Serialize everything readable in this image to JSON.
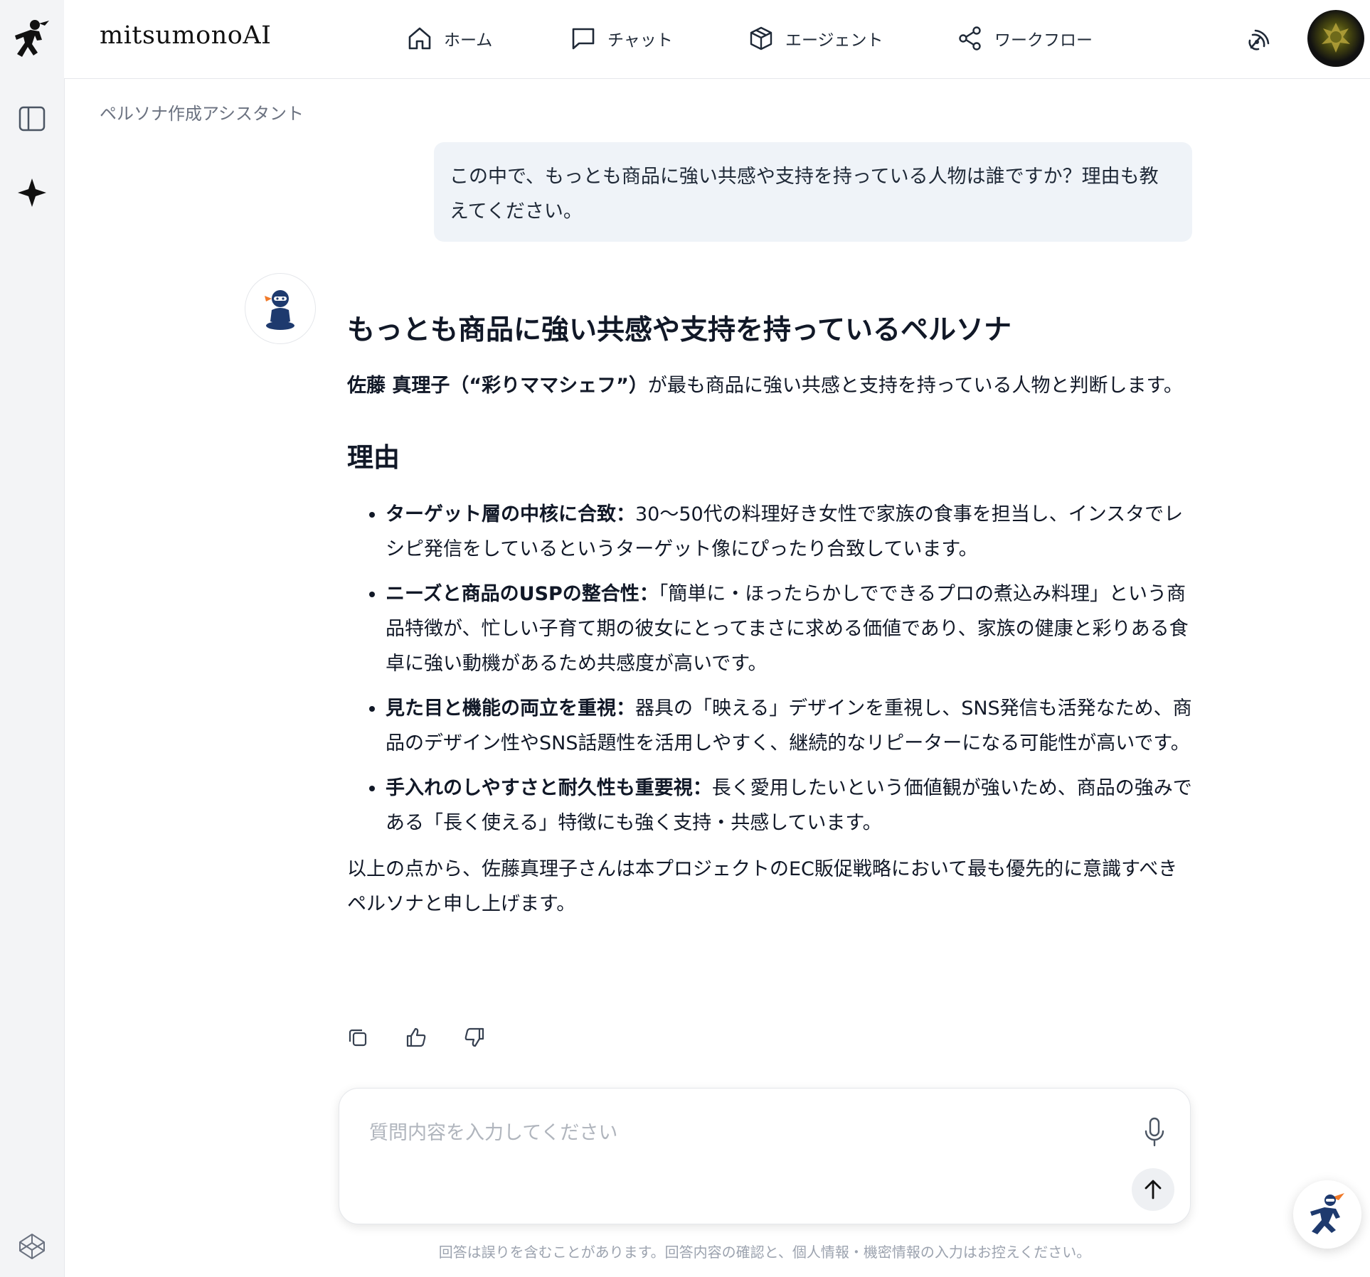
{
  "app": {
    "name": "mitsumonoAI"
  },
  "nav": [
    {
      "label": "ホーム",
      "icon": "home-icon"
    },
    {
      "label": "チャット",
      "icon": "chat-icon"
    },
    {
      "label": "エージェント",
      "icon": "cube-icon"
    },
    {
      "label": "ワークフロー",
      "icon": "share-icon"
    }
  ],
  "header": {
    "broadcast_icon": "broadcast-icon"
  },
  "sidebar": {
    "icons": [
      "ninja-logo-icon",
      "panel-toggle-icon",
      "sparkle-icon",
      "codepen-icon"
    ]
  },
  "breadcrumb": "ペルソナ作成アシスタント",
  "user_message": "この中で、もっとも商品に強い共感や支持を持っている人物は誰ですか？理由も教えてください。",
  "answer": {
    "title": "もっとも商品に強い共感や支持を持っているペルソナ",
    "intro_strong": "佐藤 真理子（“彩りママシェフ”）",
    "intro_rest": "が最も商品に強い共感と支持を持っている人物と判断します。",
    "reasons_heading": "理由",
    "reasons": [
      {
        "strong": "ターゲット層の中核に合致：",
        "text": "30〜50代の料理好き女性で家族の食事を担当し、インスタでレシピ発信をしているというターゲット像にぴったり合致しています。"
      },
      {
        "strong": "ニーズと商品のUSPの整合性：",
        "text": "「簡単に・ほったらかしでできるプロの煮込み料理」という商品特徴が、忙しい子育て期の彼女にとってまさに求める価値であり、家族の健康と彩りある食卓に強い動機があるため共感度が高いです。"
      },
      {
        "strong": "見た目と機能の両立を重視：",
        "text": "器具の「映える」デザインを重視し、SNS発信も活発なため、商品のデザイン性やSNS話題性を活用しやすく、継続的なリピーターになる可能性が高いです。"
      },
      {
        "strong": "手入れのしやすさと耐久性も重要視：",
        "text": "長く愛用したいという価値観が強いため、商品の強みである「長く使える」特徴にも強く支持・共感しています。"
      }
    ],
    "conclusion": "以上の点から、佐藤真理子さんは本プロジェクトのEC販促戦略において最も優先的に意識すべきペルソナと申し上げます。"
  },
  "actions": [
    "copy-icon",
    "thumbs-up-icon",
    "thumbs-down-icon"
  ],
  "composer": {
    "placeholder": "質問内容を入力してください"
  },
  "disclaimer": "回答は誤りを含むことがあります。回答内容の確認と、個人情報・機密情報の入力はお控えください。",
  "colors": {
    "sidebar_bg": "#f3f4f6",
    "user_bubble_bg": "#eff3f8",
    "ninja_navy": "#1e3a6e",
    "ninja_orange": "#f07a2a"
  }
}
